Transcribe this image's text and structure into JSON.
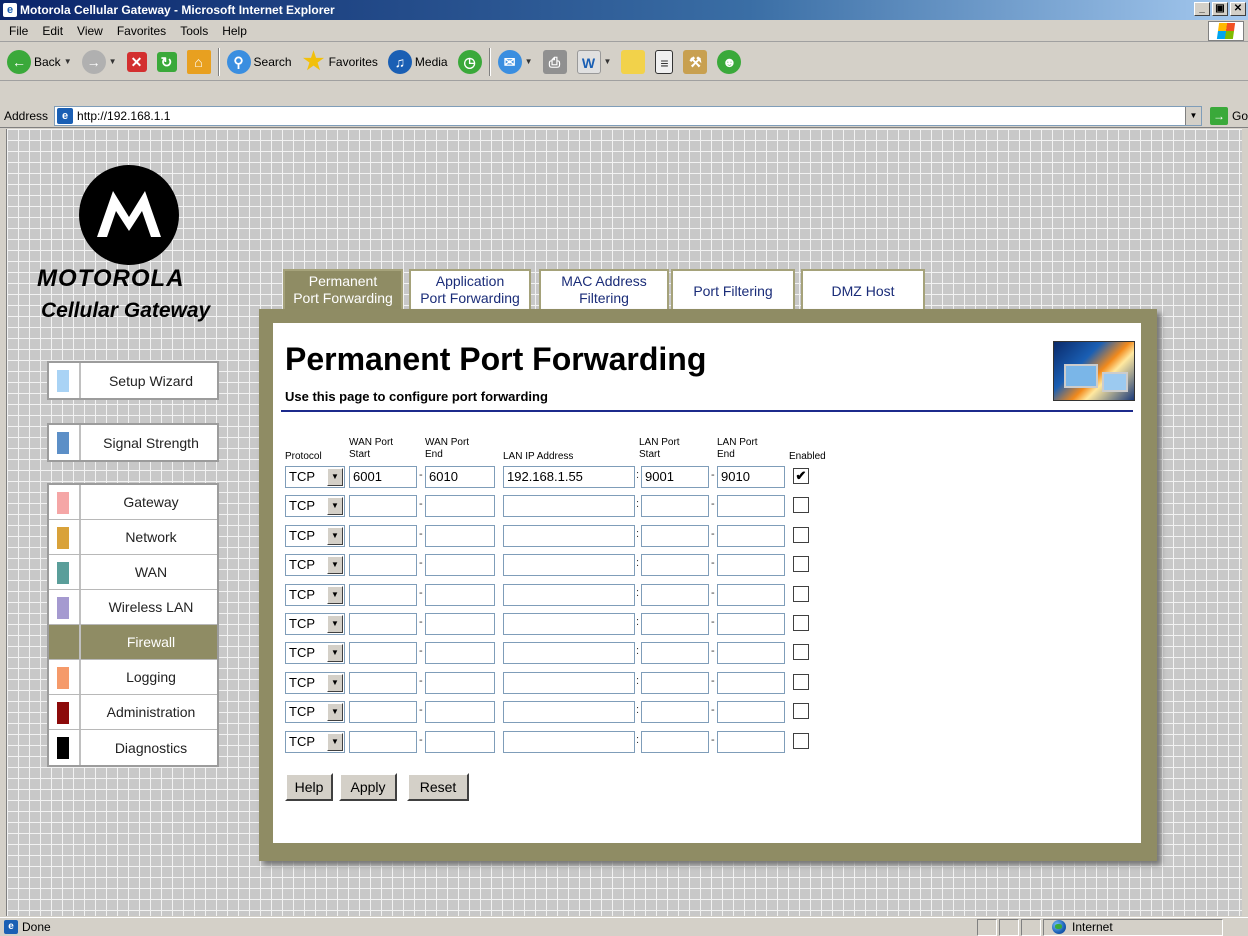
{
  "window": {
    "title": "Motorola Cellular Gateway - Microsoft Internet Explorer"
  },
  "menu": [
    "File",
    "Edit",
    "View",
    "Favorites",
    "Tools",
    "Help"
  ],
  "toolbar": {
    "back": "Back",
    "search": "Search",
    "favorites": "Favorites",
    "media": "Media"
  },
  "address": {
    "label": "Address",
    "url": "http://192.168.1.1",
    "go": "Go"
  },
  "brand": {
    "name": "MOTOROLA",
    "subtitle": "Cellular Gateway"
  },
  "sidebar": {
    "top": [
      {
        "label": "Setup Wizard",
        "color": "#a9d3f5"
      },
      {
        "label": "Signal Strength",
        "color": "#5c8fc7"
      }
    ],
    "items": [
      {
        "label": "Gateway",
        "color": "#f5a6a6"
      },
      {
        "label": "Network",
        "color": "#d9a23a"
      },
      {
        "label": "WAN",
        "color": "#5a9e9a"
      },
      {
        "label": "Wireless LAN",
        "color": "#a59ad0"
      },
      {
        "label": "Firewall",
        "color": "#8f8c64",
        "active": true
      },
      {
        "label": "Logging",
        "color": "#f59a6a"
      },
      {
        "label": "Administration",
        "color": "#8c0a0a"
      },
      {
        "label": "Diagnostics",
        "color": "#000000"
      }
    ]
  },
  "tabs": [
    {
      "line1": "Permanent",
      "line2": "Port Forwarding",
      "active": true
    },
    {
      "line1": "Application",
      "line2": "Port Forwarding"
    },
    {
      "line1": "MAC Address",
      "line2": "Filtering"
    },
    {
      "line1": "Port Filtering",
      "line2": ""
    },
    {
      "line1": "DMZ Host",
      "line2": ""
    }
  ],
  "page": {
    "title": "Permanent Port Forwarding",
    "description": "Use this page to configure port forwarding"
  },
  "table": {
    "headers": {
      "protocol": "Protocol",
      "wan_start": [
        "WAN Port",
        "Start"
      ],
      "wan_end": [
        "WAN Port",
        "End"
      ],
      "lan_ip": "LAN IP Address",
      "lan_start": [
        "LAN Port",
        "Start"
      ],
      "lan_end": [
        "LAN Port",
        "End"
      ],
      "enabled": "Enabled"
    },
    "rows": [
      {
        "protocol": "TCP",
        "wan_start": "6001",
        "wan_end": "6010",
        "lan_ip": "192.168.1.55",
        "lan_start": "9001",
        "lan_end": "9010",
        "enabled": true
      },
      {
        "protocol": "TCP",
        "wan_start": "",
        "wan_end": "",
        "lan_ip": "",
        "lan_start": "",
        "lan_end": "",
        "enabled": false
      },
      {
        "protocol": "TCP",
        "wan_start": "",
        "wan_end": "",
        "lan_ip": "",
        "lan_start": "",
        "lan_end": "",
        "enabled": false
      },
      {
        "protocol": "TCP",
        "wan_start": "",
        "wan_end": "",
        "lan_ip": "",
        "lan_start": "",
        "lan_end": "",
        "enabled": false
      },
      {
        "protocol": "TCP",
        "wan_start": "",
        "wan_end": "",
        "lan_ip": "",
        "lan_start": "",
        "lan_end": "",
        "enabled": false
      },
      {
        "protocol": "TCP",
        "wan_start": "",
        "wan_end": "",
        "lan_ip": "",
        "lan_start": "",
        "lan_end": "",
        "enabled": false
      },
      {
        "protocol": "TCP",
        "wan_start": "",
        "wan_end": "",
        "lan_ip": "",
        "lan_start": "",
        "lan_end": "",
        "enabled": false
      },
      {
        "protocol": "TCP",
        "wan_start": "",
        "wan_end": "",
        "lan_ip": "",
        "lan_start": "",
        "lan_end": "",
        "enabled": false
      },
      {
        "protocol": "TCP",
        "wan_start": "",
        "wan_end": "",
        "lan_ip": "",
        "lan_start": "",
        "lan_end": "",
        "enabled": false
      },
      {
        "protocol": "TCP",
        "wan_start": "",
        "wan_end": "",
        "lan_ip": "",
        "lan_start": "",
        "lan_end": "",
        "enabled": false
      }
    ]
  },
  "buttons": {
    "help": "Help",
    "apply": "Apply",
    "reset": "Reset"
  },
  "status": {
    "text": "Done",
    "zone": "Internet"
  }
}
